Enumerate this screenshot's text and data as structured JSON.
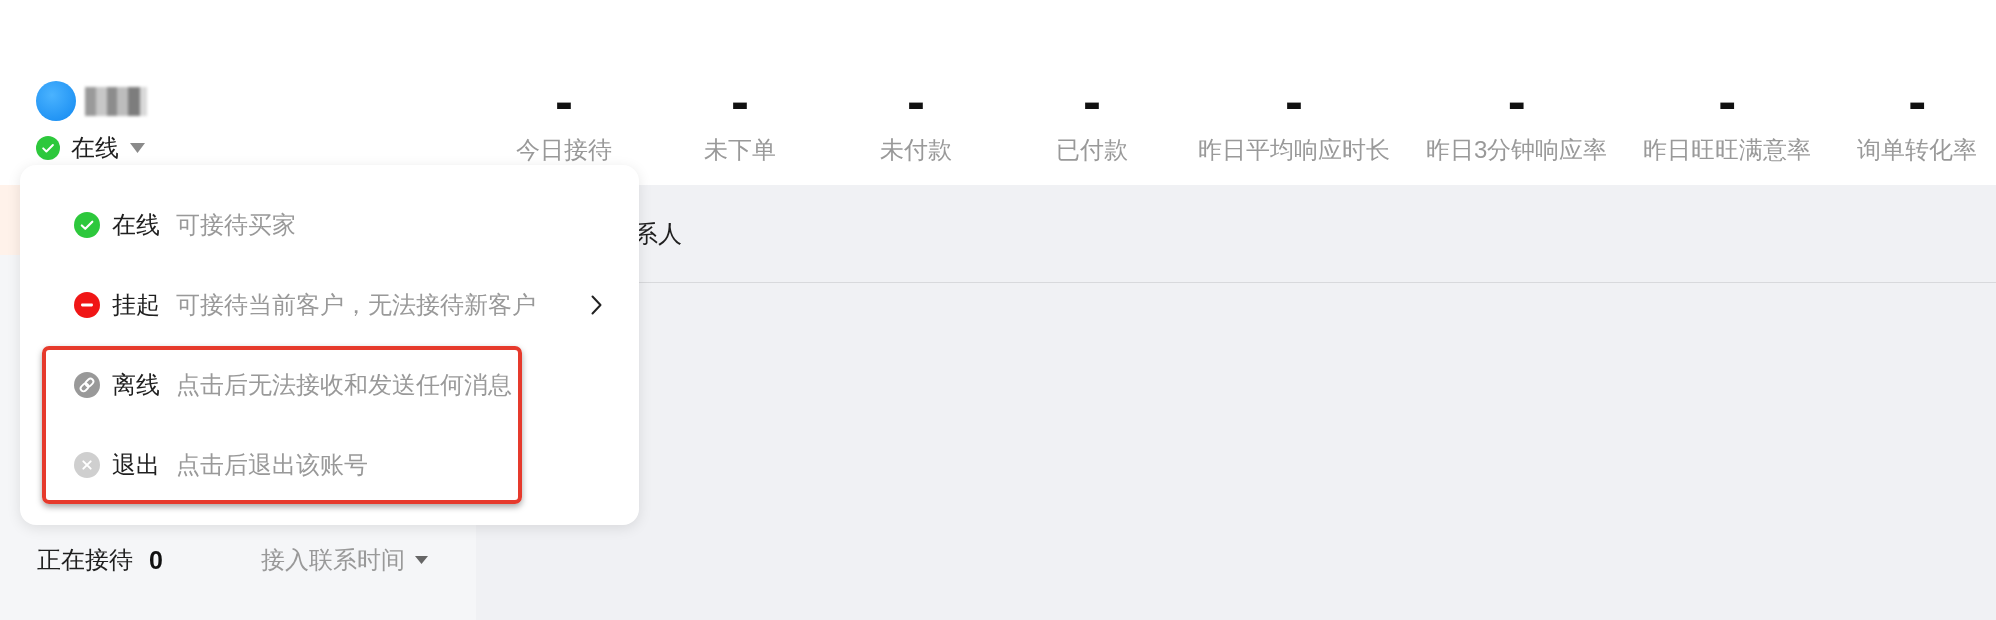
{
  "header": {
    "profile": {
      "status": {
        "kind": "online",
        "label": "在线"
      }
    },
    "stats": [
      {
        "value": "-",
        "label": "今日接待"
      },
      {
        "value": "-",
        "label": "未下单"
      },
      {
        "value": "-",
        "label": "未付款"
      },
      {
        "value": "-",
        "label": "已付款"
      },
      {
        "value": "-",
        "label": "昨日平均响应时长"
      },
      {
        "value": "-",
        "label": "昨日3分钟响应率"
      },
      {
        "value": "-",
        "label": "昨日旺旺满意率"
      },
      {
        "value": "-",
        "label": "询单转化率"
      }
    ]
  },
  "status_menu": {
    "items": [
      {
        "kind": "online",
        "label": "在线",
        "description": "可接待买家",
        "submenu": false,
        "highlighted": false
      },
      {
        "kind": "busy",
        "label": "挂起",
        "description": "可接待当前客户，无法接待新客户",
        "submenu": true,
        "highlighted": false
      },
      {
        "kind": "offline",
        "label": "离线",
        "description": "点击后无法接收和发送任何消息",
        "submenu": false,
        "highlighted": true
      },
      {
        "kind": "logout",
        "label": "退出",
        "description": "点击后退出该账号",
        "submenu": false,
        "highlighted": true
      }
    ]
  },
  "sidebar": {
    "list_header": {
      "label": "正在接待",
      "count": "0",
      "sort": "接入联系时间"
    }
  },
  "main": {
    "header": {
      "title": "系人"
    }
  }
}
